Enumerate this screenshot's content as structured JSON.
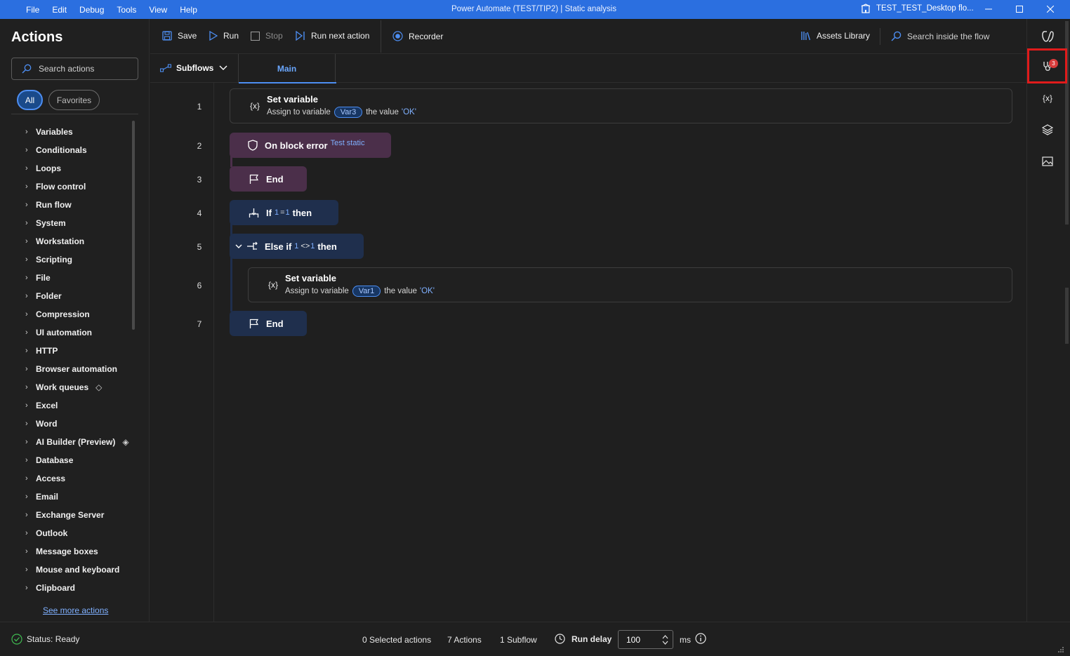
{
  "titlebar": {
    "menu": [
      "File",
      "Edit",
      "Debug",
      "Tools",
      "View",
      "Help"
    ],
    "title": "Power Automate (TEST/TIP2) | Static analysis",
    "account": "TEST_TEST_Desktop flo...",
    "bg_color": "#2b6fe0"
  },
  "actions_panel": {
    "heading": "Actions",
    "search_placeholder": "Search actions",
    "filter_all": "All",
    "filter_favorites": "Favorites",
    "categories": [
      "Variables",
      "Conditionals",
      "Loops",
      "Flow control",
      "Run flow",
      "System",
      "Workstation",
      "Scripting",
      "File",
      "Folder",
      "Compression",
      "UI automation",
      "HTTP",
      "Browser automation",
      "Work queues",
      "Excel",
      "Word",
      "AI Builder (Preview)",
      "Database",
      "Access",
      "Email",
      "Exchange Server",
      "Outlook",
      "Message boxes",
      "Mouse and keyboard",
      "Clipboard"
    ],
    "see_more": "See more actions"
  },
  "toolbar": {
    "save": "Save",
    "run": "Run",
    "stop": "Stop",
    "run_next": "Run next action",
    "recorder": "Recorder",
    "assets": "Assets Library",
    "search_flow": "Search inside the flow"
  },
  "tabs": {
    "subflows": "Subflows",
    "main": "Main"
  },
  "flow": {
    "line_numbers": [
      "1",
      "2",
      "3",
      "4",
      "5",
      "6",
      "7"
    ],
    "step1": {
      "title": "Set variable",
      "prefix": "Assign to variable",
      "var": "Var3",
      "mid": "the value",
      "value": "'OK'"
    },
    "step2": {
      "title": "On block error",
      "block": "Test static"
    },
    "step3": {
      "title": "End"
    },
    "step4": {
      "kw1": "If",
      "left": "1",
      "op": "=",
      "right": "1",
      "kw2": "then"
    },
    "step5": {
      "kw1": "Else if",
      "left": "1",
      "op": "<>",
      "right": "1",
      "kw2": "then"
    },
    "step6": {
      "title": "Set variable",
      "prefix": "Assign to variable",
      "var": "Var1",
      "mid": "the value",
      "value": "'OK'"
    },
    "step7": {
      "title": "End"
    }
  },
  "right_rail": {
    "errors_badge": "3",
    "variables_icon_label": "{x}"
  },
  "statusbar": {
    "status": "Status: Ready",
    "selected": "0 Selected actions",
    "actions": "7 Actions",
    "subflows": "1 Subflow",
    "run_delay_label": "Run delay",
    "run_delay_value": "100",
    "unit": "ms"
  }
}
